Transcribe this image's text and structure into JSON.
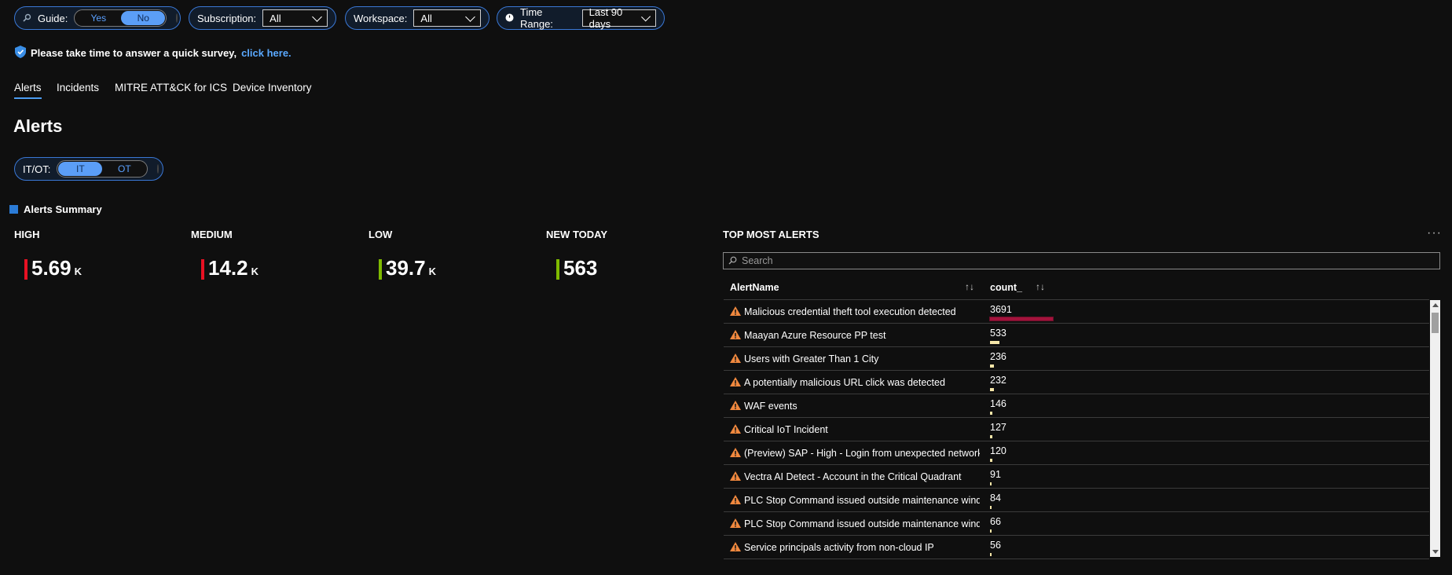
{
  "filters": {
    "guide_label": "Guide:",
    "guide_yes": "Yes",
    "guide_no": "No",
    "subscription_label": "Subscription:",
    "subscription_value": "All",
    "workspace_label": "Workspace:",
    "workspace_value": "All",
    "time_range_label": "Time Range:",
    "time_range_value": "Last 90 days"
  },
  "survey": {
    "text": "Please take time to answer a quick survey,",
    "link": "click here."
  },
  "tabs": [
    "Alerts",
    "Incidents",
    "MITRE ATT&CK for ICS",
    "Device Inventory"
  ],
  "page_title": "Alerts",
  "itot": {
    "label": "IT/OT:",
    "it": "IT",
    "ot": "OT"
  },
  "summary_title": "Alerts Summary",
  "tiles": [
    {
      "label": "HIGH",
      "value": "5.69",
      "unit": "K",
      "color": "#e81123"
    },
    {
      "label": "MEDIUM",
      "value": "14.2",
      "unit": "K",
      "color": "#e81123"
    },
    {
      "label": "LOW",
      "value": "39.7",
      "unit": "K",
      "color": "#7fba00"
    },
    {
      "label": "NEW TODAY",
      "value": "563",
      "unit": "",
      "color": "#7fba00"
    }
  ],
  "top_alerts": {
    "title": "TOP MOST ALERTS",
    "search_placeholder": "Search",
    "columns": [
      "AlertName",
      "count_"
    ],
    "rows": [
      {
        "name": "Malicious credential theft tool execution detected",
        "count": 3691
      },
      {
        "name": "Maayan Azure Resource PP test",
        "count": 533
      },
      {
        "name": "Users with Greater Than 1 City",
        "count": 236
      },
      {
        "name": "A potentially malicious URL click was detected",
        "count": 232
      },
      {
        "name": "WAF events",
        "count": 146
      },
      {
        "name": "Critical IoT Incident",
        "count": 127
      },
      {
        "name": "(Preview) SAP - High - Login from unexpected network",
        "count": 120
      },
      {
        "name": "Vectra AI Detect - Account in the Critical Quadrant",
        "count": 91
      },
      {
        "name": "PLC Stop Command issued outside maintenance window: S",
        "count": 84
      },
      {
        "name": "PLC Stop Command issued outside maintenance window: S",
        "count": 66
      },
      {
        "name": "Service principals activity from non-cloud IP",
        "count": 56
      }
    ]
  },
  "colors": {
    "accent": "#4c9bf0",
    "bar_top": "#a4133c",
    "bar_other": "#f5e6a8"
  }
}
